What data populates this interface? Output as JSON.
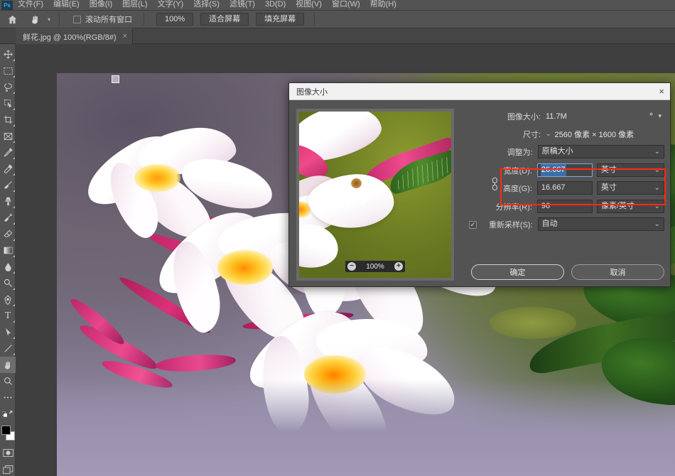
{
  "app": {
    "logo": "Ps",
    "accent": "#31a8ff"
  },
  "menubar": {
    "items": [
      {
        "label": "文件(F)"
      },
      {
        "label": "编辑(E)"
      },
      {
        "label": "图像(I)"
      },
      {
        "label": "图层(L)"
      },
      {
        "label": "文字(Y)"
      },
      {
        "label": "选择(S)"
      },
      {
        "label": "滤镜(T)"
      },
      {
        "label": "3D(D)"
      },
      {
        "label": "视图(V)"
      },
      {
        "label": "窗口(W)"
      },
      {
        "label": "帮助(H)"
      }
    ]
  },
  "optionsbar": {
    "home_icon": "home-icon",
    "tool_icon": "hand-tool-icon",
    "preset_caret": "chevron-down-icon",
    "scroll_all_windows": {
      "label": "滚动所有窗口",
      "checked": false
    },
    "buttons": [
      {
        "label": "100%",
        "name": "zoom-100-button"
      },
      {
        "label": "适合屏幕",
        "name": "fit-screen-button"
      },
      {
        "label": "填充屏幕",
        "name": "fill-screen-button"
      }
    ]
  },
  "tabbar": {
    "tab": {
      "label": "鲜花.jpg @ 100%(RGB/8#)",
      "close": "×"
    }
  },
  "toolbar": {
    "tools": [
      {
        "name": "move-tool-icon",
        "glyph": "move"
      },
      {
        "name": "rectangular-marquee-tool-icon",
        "glyph": "marquee"
      },
      {
        "name": "lasso-tool-icon",
        "glyph": "lasso"
      },
      {
        "name": "quick-selection-tool-icon",
        "glyph": "quickselect"
      },
      {
        "name": "crop-tool-icon",
        "glyph": "crop"
      },
      {
        "name": "frame-tool-icon",
        "glyph": "frame"
      },
      {
        "name": "eyedropper-tool-icon",
        "glyph": "eyedropper"
      },
      {
        "name": "spot-healing-brush-tool-icon",
        "glyph": "heal"
      },
      {
        "name": "brush-tool-icon",
        "glyph": "brush"
      },
      {
        "name": "clone-stamp-tool-icon",
        "glyph": "stamp"
      },
      {
        "name": "history-brush-tool-icon",
        "glyph": "historybrush"
      },
      {
        "name": "eraser-tool-icon",
        "glyph": "eraser"
      },
      {
        "name": "gradient-tool-icon",
        "glyph": "gradient"
      },
      {
        "name": "blur-tool-icon",
        "glyph": "blur"
      },
      {
        "name": "dodge-tool-icon",
        "glyph": "dodge"
      },
      {
        "name": "pen-tool-icon",
        "glyph": "pen"
      },
      {
        "name": "type-tool-icon",
        "glyph": "type"
      },
      {
        "name": "path-selection-tool-icon",
        "glyph": "pathselect"
      },
      {
        "name": "line-tool-icon",
        "glyph": "line"
      },
      {
        "name": "hand-tool-icon",
        "glyph": "hand",
        "active": true
      },
      {
        "name": "zoom-tool-icon",
        "glyph": "zoom"
      },
      {
        "name": "edit-toolbar-icon",
        "glyph": "dots"
      },
      {
        "name": "default-colors-icon",
        "glyph": "swapcolors"
      }
    ],
    "foreground_color": "#000000",
    "background_color": "#ffffff",
    "quick_mask_icon": "quick-mask-icon",
    "screen_mode_icon": "screen-mode-icon"
  },
  "dialog": {
    "title": "图像大小",
    "close": "×",
    "preview": {
      "zoom_out": "−",
      "zoom_value": "100%",
      "zoom_in": "+"
    },
    "image_size": {
      "label": "图像大小:",
      "value": "11.7M",
      "gear_icon": "gear-icon"
    },
    "dimensions": {
      "label": "尺寸:",
      "caret": "chevron-down-icon",
      "value": "2560 像素 × 1600 像素"
    },
    "fit_to": {
      "label": "调整为:",
      "value": "原稿大小"
    },
    "width": {
      "label": "宽度(D):",
      "value": "26.667",
      "unit": "英寸",
      "focused": true,
      "selected": true
    },
    "height": {
      "label": "高度(G):",
      "value": "16.667",
      "unit": "英寸"
    },
    "resolution": {
      "label": "分辨率(R):",
      "value": "96",
      "unit": "像素/英寸"
    },
    "resample": {
      "label": "重新采样(S):",
      "value": "自动",
      "checked": true
    },
    "link_icon": "chain-link-icon",
    "highlight_color": "#ff2a13",
    "buttons": {
      "ok": "确定",
      "cancel": "取消"
    }
  },
  "canvas": {
    "document_name": "鲜花.jpg",
    "background_color": "#8e87a0",
    "handle": "transform-handle"
  }
}
